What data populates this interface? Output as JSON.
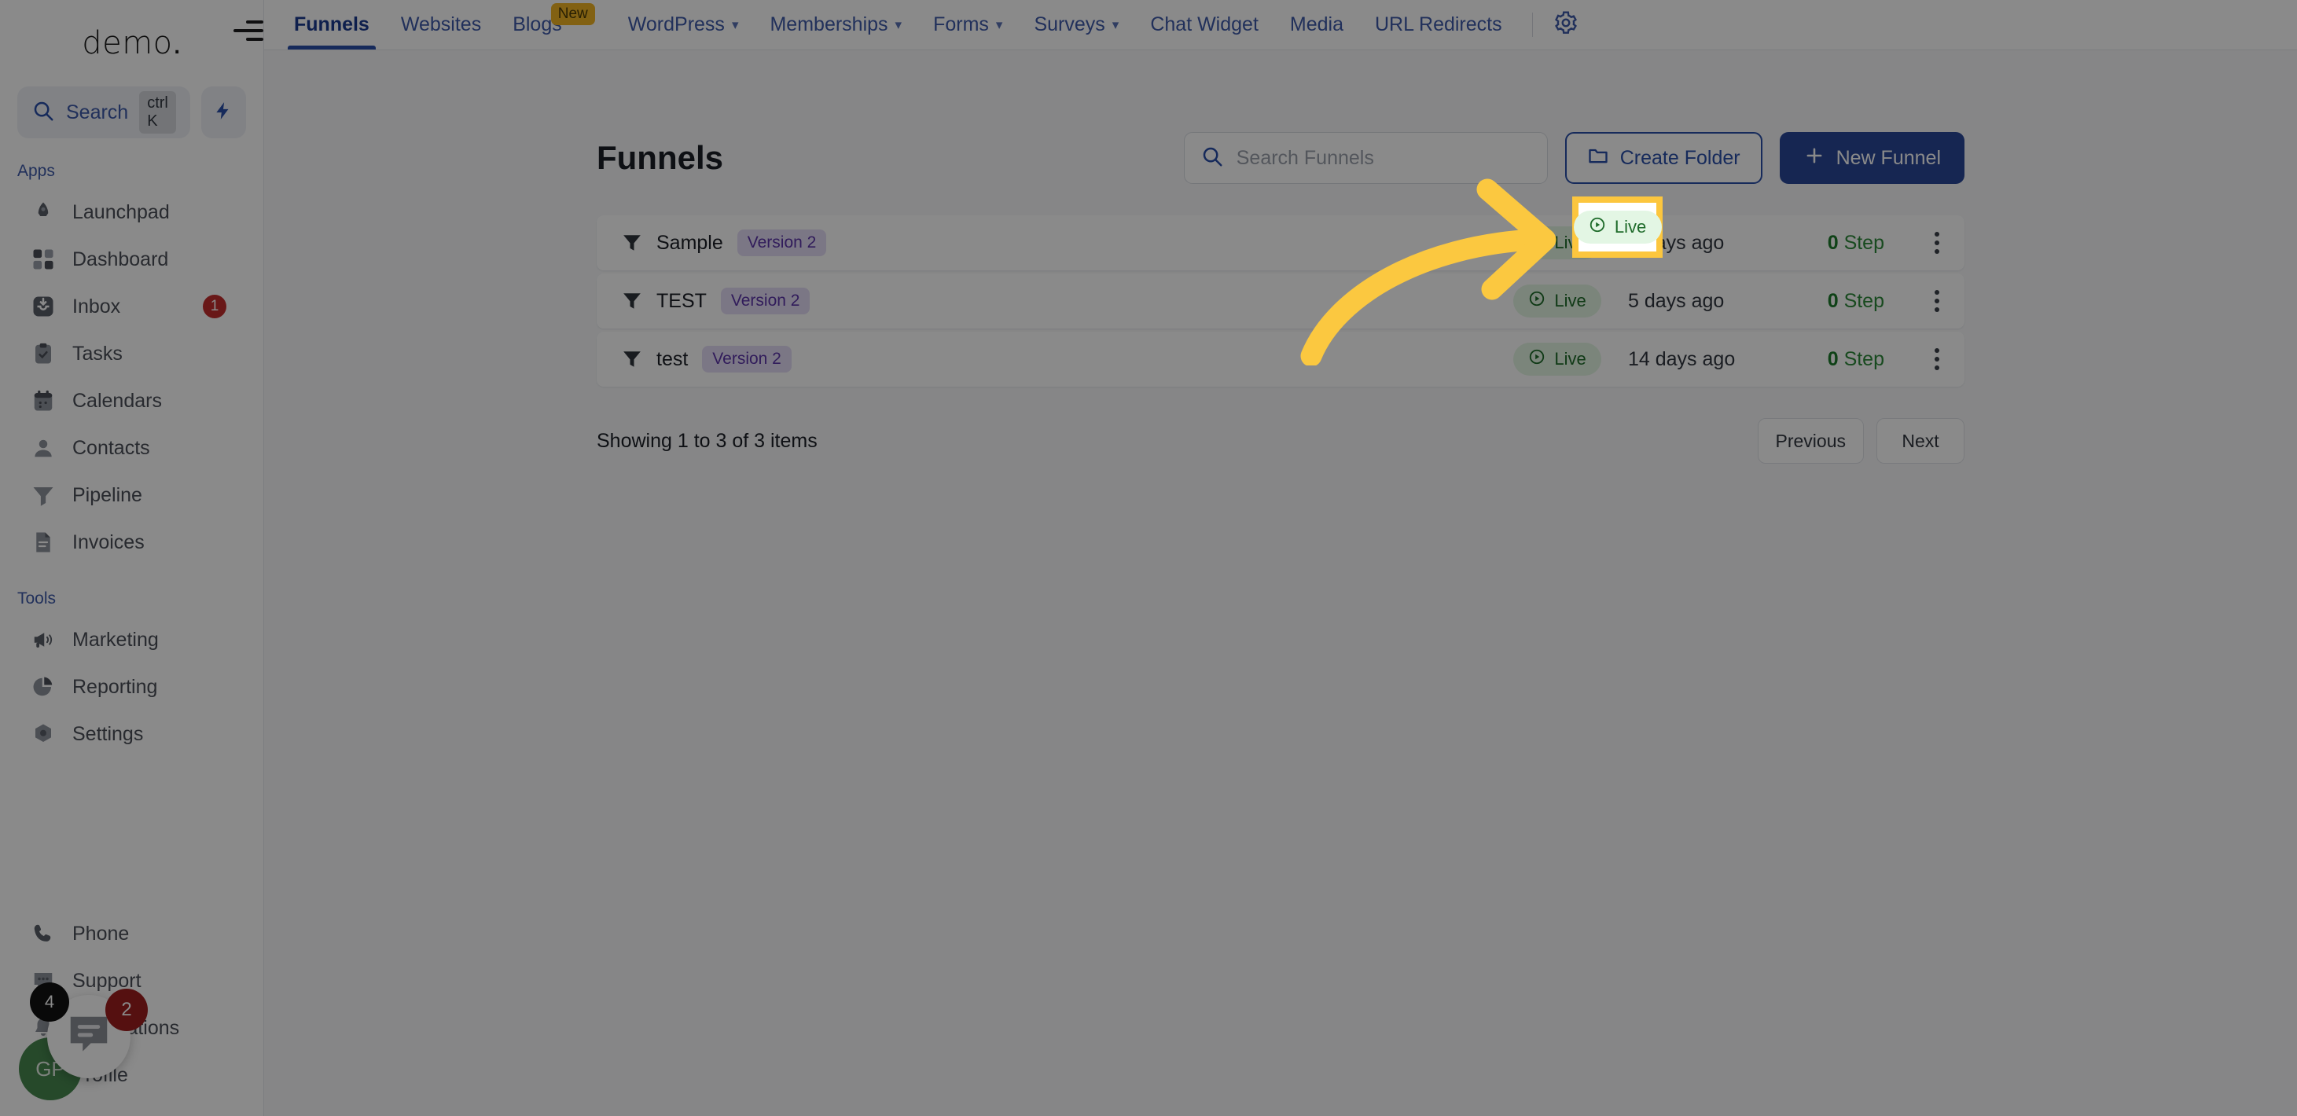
{
  "brand": {
    "name": "demo",
    "dot": "."
  },
  "sidebar": {
    "search": {
      "label": "Search",
      "shortcut": "ctrl K",
      "icon": "search-icon"
    },
    "quick_action_icon": "bolt-icon",
    "sections": [
      {
        "label": "Apps",
        "items": [
          {
            "label": "Launchpad",
            "icon": "rocket-icon",
            "badge": ""
          },
          {
            "label": "Dashboard",
            "icon": "grid-icon",
            "badge": ""
          },
          {
            "label": "Inbox",
            "icon": "inbox-icon",
            "badge": "1"
          },
          {
            "label": "Tasks",
            "icon": "clipboard-check-icon",
            "badge": ""
          },
          {
            "label": "Calendars",
            "icon": "calendar-icon",
            "badge": ""
          },
          {
            "label": "Contacts",
            "icon": "user-icon",
            "badge": ""
          },
          {
            "label": "Pipeline",
            "icon": "funnel-icon",
            "badge": ""
          },
          {
            "label": "Invoices",
            "icon": "document-icon",
            "badge": ""
          }
        ]
      },
      {
        "label": "Tools",
        "items": [
          {
            "label": "Marketing",
            "icon": "megaphone-icon",
            "badge": ""
          },
          {
            "label": "Reporting",
            "icon": "pie-chart-icon",
            "badge": ""
          },
          {
            "label": "Settings",
            "icon": "gear-icon",
            "badge": ""
          }
        ]
      }
    ],
    "bottom_items": [
      {
        "label": "Phone",
        "icon": "phone-icon",
        "badge": ""
      },
      {
        "label": "Support",
        "icon": "chat-dots-icon",
        "badge": ""
      },
      {
        "label": "Notifications",
        "icon": "bell-icon",
        "badge": ""
      },
      {
        "label": "Profile",
        "icon": "avatar-icon",
        "badge": ""
      }
    ],
    "chat_widget": {
      "icon": "chat-bubble-icon",
      "badge_dark": "4",
      "badge_red": "2"
    },
    "avatar": {
      "initials": "GP"
    }
  },
  "topnav": {
    "collapse_icon": "collapse-sidebar-icon",
    "tabs": [
      {
        "label": "Funnels",
        "active": true,
        "caret": false,
        "pill": ""
      },
      {
        "label": "Websites",
        "active": false,
        "caret": false,
        "pill": ""
      },
      {
        "label": "Blogs",
        "active": false,
        "caret": false,
        "pill": "New"
      },
      {
        "label": "WordPress",
        "active": false,
        "caret": true,
        "pill": ""
      },
      {
        "label": "Memberships",
        "active": false,
        "caret": true,
        "pill": ""
      },
      {
        "label": "Forms",
        "active": false,
        "caret": true,
        "pill": ""
      },
      {
        "label": "Surveys",
        "active": false,
        "caret": true,
        "pill": ""
      },
      {
        "label": "Chat Widget",
        "active": false,
        "caret": false,
        "pill": ""
      },
      {
        "label": "Media",
        "active": false,
        "caret": false,
        "pill": ""
      },
      {
        "label": "URL Redirects",
        "active": false,
        "caret": false,
        "pill": ""
      }
    ],
    "settings_icon": "gear-icon"
  },
  "main": {
    "title": "Funnels",
    "search": {
      "placeholder": "Search Funnels",
      "value": "",
      "icon": "search-icon"
    },
    "create_folder_label": "Create Folder",
    "new_funnel_label": "New Funnel",
    "rows": [
      {
        "name": "Sample",
        "version": "Version 2",
        "status": "Live",
        "updated": "5 days ago",
        "step_count": "0",
        "step_label": "Step"
      },
      {
        "name": "TEST",
        "version": "Version 2",
        "status": "Live",
        "updated": "5 days ago",
        "step_count": "0",
        "step_label": "Step"
      },
      {
        "name": "test",
        "version": "Version 2",
        "status": "Live",
        "updated": "14 days ago",
        "step_count": "0",
        "step_label": "Step"
      }
    ],
    "showing_text": "Showing 1 to 3 of 3 items",
    "pagination": {
      "previous": "Previous",
      "next": "Next"
    }
  },
  "annotation": {
    "highlight_status": "Live",
    "arrow_color": "#fbc840",
    "highlight_border_color": "#fcc63e"
  },
  "colors": {
    "accent_blue": "#2a4fa8",
    "primary_button": "#2a4798",
    "live_green_bg": "#e3f6e4",
    "live_green_text": "#1e6b2a",
    "version_pill_bg": "#e4dcf5",
    "version_pill_text": "#5b34a8",
    "badge_red": "#c32e2e",
    "new_pill": "#f0b323"
  }
}
